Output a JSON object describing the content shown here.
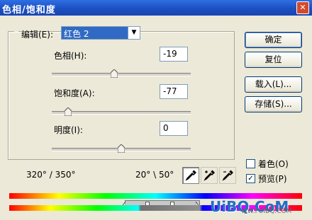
{
  "window": {
    "title": "色相/饱和度",
    "close_glyph": "✕"
  },
  "edit": {
    "label": "编辑(E):",
    "selected": "红色 2",
    "arrow": "▼"
  },
  "hue": {
    "label": "色相(H):",
    "value": "-19",
    "level": -19
  },
  "saturation": {
    "label": "饱和度(A):",
    "value": "-77",
    "level": -77
  },
  "lightness": {
    "label": "明度(I):",
    "value": "0",
    "level": 0
  },
  "buttons": {
    "ok": "确定",
    "reset": "复位",
    "load": "载入(L)...",
    "save": "存储(S)..."
  },
  "checkboxes": {
    "colorize": {
      "label": "着色(O)",
      "checked": false
    },
    "preview": {
      "label": "预览(P)",
      "checked": true,
      "mark": "✓"
    }
  },
  "ranges": {
    "left": "320° / 350°",
    "right": "20° \\ 50°"
  },
  "tools": [
    "eyedropper-icon",
    "eyedropper-plus-icon",
    "eyedropper-minus-icon"
  ],
  "watermark": {
    "text": "UiBQ.CoM",
    "sub": "WW.FUIBQ.COM"
  },
  "colors": {
    "title_bar": "#1b4fc0",
    "dialog_bg": "#ece9d8",
    "selection": "#316ac5"
  }
}
